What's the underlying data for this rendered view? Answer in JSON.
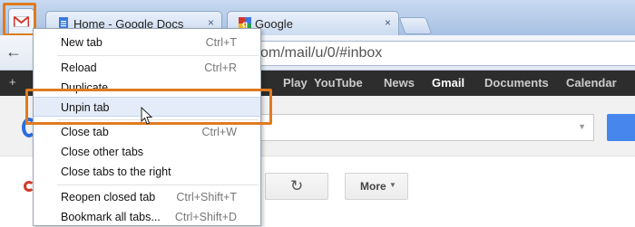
{
  "tabs": {
    "pinned": {
      "icon": "gmail-icon"
    },
    "items": [
      {
        "title": "Home - Google Docs",
        "icon": "docs-icon",
        "close": "×"
      },
      {
        "title": "Google",
        "icon": "google-icon",
        "close": "×"
      }
    ]
  },
  "toolbar": {
    "back": "←",
    "url": "om/mail/u/0/#inbox"
  },
  "gbar": {
    "plus": "+",
    "items": [
      "Play",
      "YouTube",
      "News",
      "Gmail",
      "Documents",
      "Calendar"
    ],
    "active": "Gmail"
  },
  "context_menu": {
    "items": [
      {
        "label": "New tab",
        "shortcut": "Ctrl+T"
      },
      {
        "label": "Reload",
        "shortcut": "Ctrl+R"
      },
      {
        "label": "Duplicate",
        "shortcut": ""
      },
      {
        "label": "Unpin tab",
        "shortcut": ""
      },
      {
        "label": "Close tab",
        "shortcut": "Ctrl+W"
      },
      {
        "label": "Close other tabs",
        "shortcut": ""
      },
      {
        "label": "Close tabs to the right",
        "shortcut": ""
      },
      {
        "label": "Reopen closed tab",
        "shortcut": "Ctrl+Shift+T"
      },
      {
        "label": "Bookmark all tabs...",
        "shortcut": "Ctrl+Shift+D"
      }
    ],
    "hovered": "Unpin tab"
  },
  "page": {
    "more_label": "More",
    "refresh_icon": "↻"
  },
  "colors": {
    "highlight": "#e07b1f",
    "gbar_bg": "#2d2d2d",
    "search_button": "#4787ed"
  }
}
